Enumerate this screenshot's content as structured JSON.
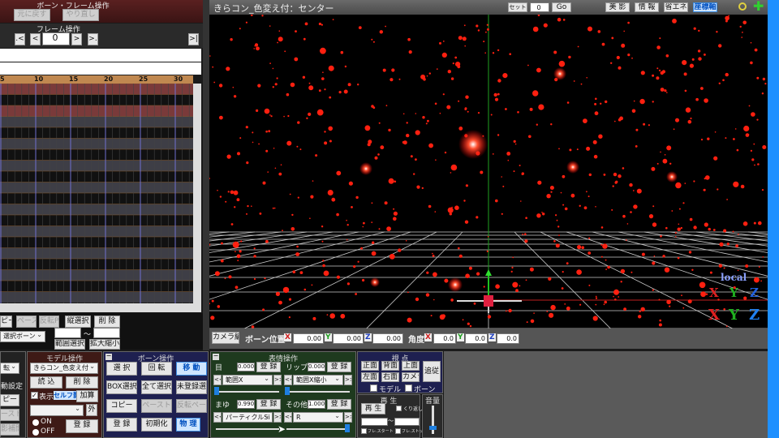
{
  "left": {
    "top_title": "ボーン・フレーム操作",
    "undo": "元に戻す",
    "redo": "やり直し",
    "frame_title": "フレーム操作",
    "frame_value": "0",
    "nav": {
      "first": ".<",
      "prev": "<",
      "next": ">",
      "last": ">.",
      "end": ">|"
    },
    "ruler": [
      "5",
      "10",
      "15",
      "20",
      "25",
      "30"
    ],
    "buttons": {
      "copy": "ピー",
      "paste": "ペースト",
      "flip": "反転P",
      "vsel": "縦選択",
      "del": "削 除",
      "range": "範囲選択",
      "scale": "拡大縮小"
    },
    "bone_select": "選択ボーン",
    "range_sep": "～"
  },
  "partial": {
    "dropdown": "転",
    "auto": "動設定",
    "copy": "ピー",
    "paste": "ースト",
    "interp": "影補間"
  },
  "model": {
    "title": "モデル操作",
    "model_select": "きらコン_色変え付",
    "load": "読 込",
    "delete": "削 除",
    "show": "表示",
    "self_shadow": "セルフ影",
    "add": "加算",
    "outside": "外",
    "on": "ON",
    "off": "OFF",
    "register": "登 録"
  },
  "bone": {
    "title": "ボーン操作",
    "select": "選 択",
    "rotate": "回 転",
    "move": "移 動",
    "box": "BOX選択",
    "all": "全て選択",
    "unreg": "未登録選",
    "copy": "コピー",
    "paste": "ペースト",
    "flip_paste": "反転ペースト",
    "register": "登 録",
    "init": "初期化",
    "physics": "物 理"
  },
  "viewport": {
    "title": "きらコン_色変え付：センター",
    "set": "セット",
    "set_value": "0",
    "go": "Go",
    "btn_shadow": "美 影",
    "btn_info": "情 報",
    "btn_eco": "省エネ",
    "btn_axis": "座標軸",
    "local": "local",
    "axes": [
      "X",
      "Y",
      "Z"
    ],
    "star_color": "#ff2010",
    "grid_color": "#ffffff"
  },
  "camera_bar": {
    "camera_edit": "カメラ編",
    "bone_pos": "ボーン位置",
    "pos": [
      "0.00",
      "0.00",
      "0.00"
    ],
    "angle": "角度",
    "rot": [
      "0.0",
      "0.0",
      "0.0"
    ]
  },
  "morph": {
    "title": "表情操作",
    "eye": {
      "label": "目",
      "value": "0.000",
      "select": "範囲X",
      "slider": 0
    },
    "lip": {
      "label": "リップ",
      "value": "0.000",
      "select": "範囲X縮小",
      "slider": 0
    },
    "brow": {
      "label": "まゆ",
      "value": "0.990",
      "select": "パーティクルSi",
      "slider": 0.99
    },
    "other": {
      "label": "その他",
      "value": "1.000",
      "select": "R",
      "slider": 1
    },
    "register": "登 録",
    "prev": "<<",
    "next": ">>"
  },
  "view": {
    "title": "視 点",
    "front": "正面",
    "back": "背面",
    "top": "上面",
    "left": "左面",
    "right": "右面",
    "camera": "カメラ",
    "follow": "追従",
    "model": "モデル",
    "bone": "ボーン"
  },
  "play": {
    "title": "再 生",
    "play": "再 生",
    "loop": "くり返し",
    "start": "フレ.スタート",
    "stop": "フレ.ストップ",
    "sep": "～"
  },
  "volume": {
    "title": "音量",
    "level": 0.2
  }
}
